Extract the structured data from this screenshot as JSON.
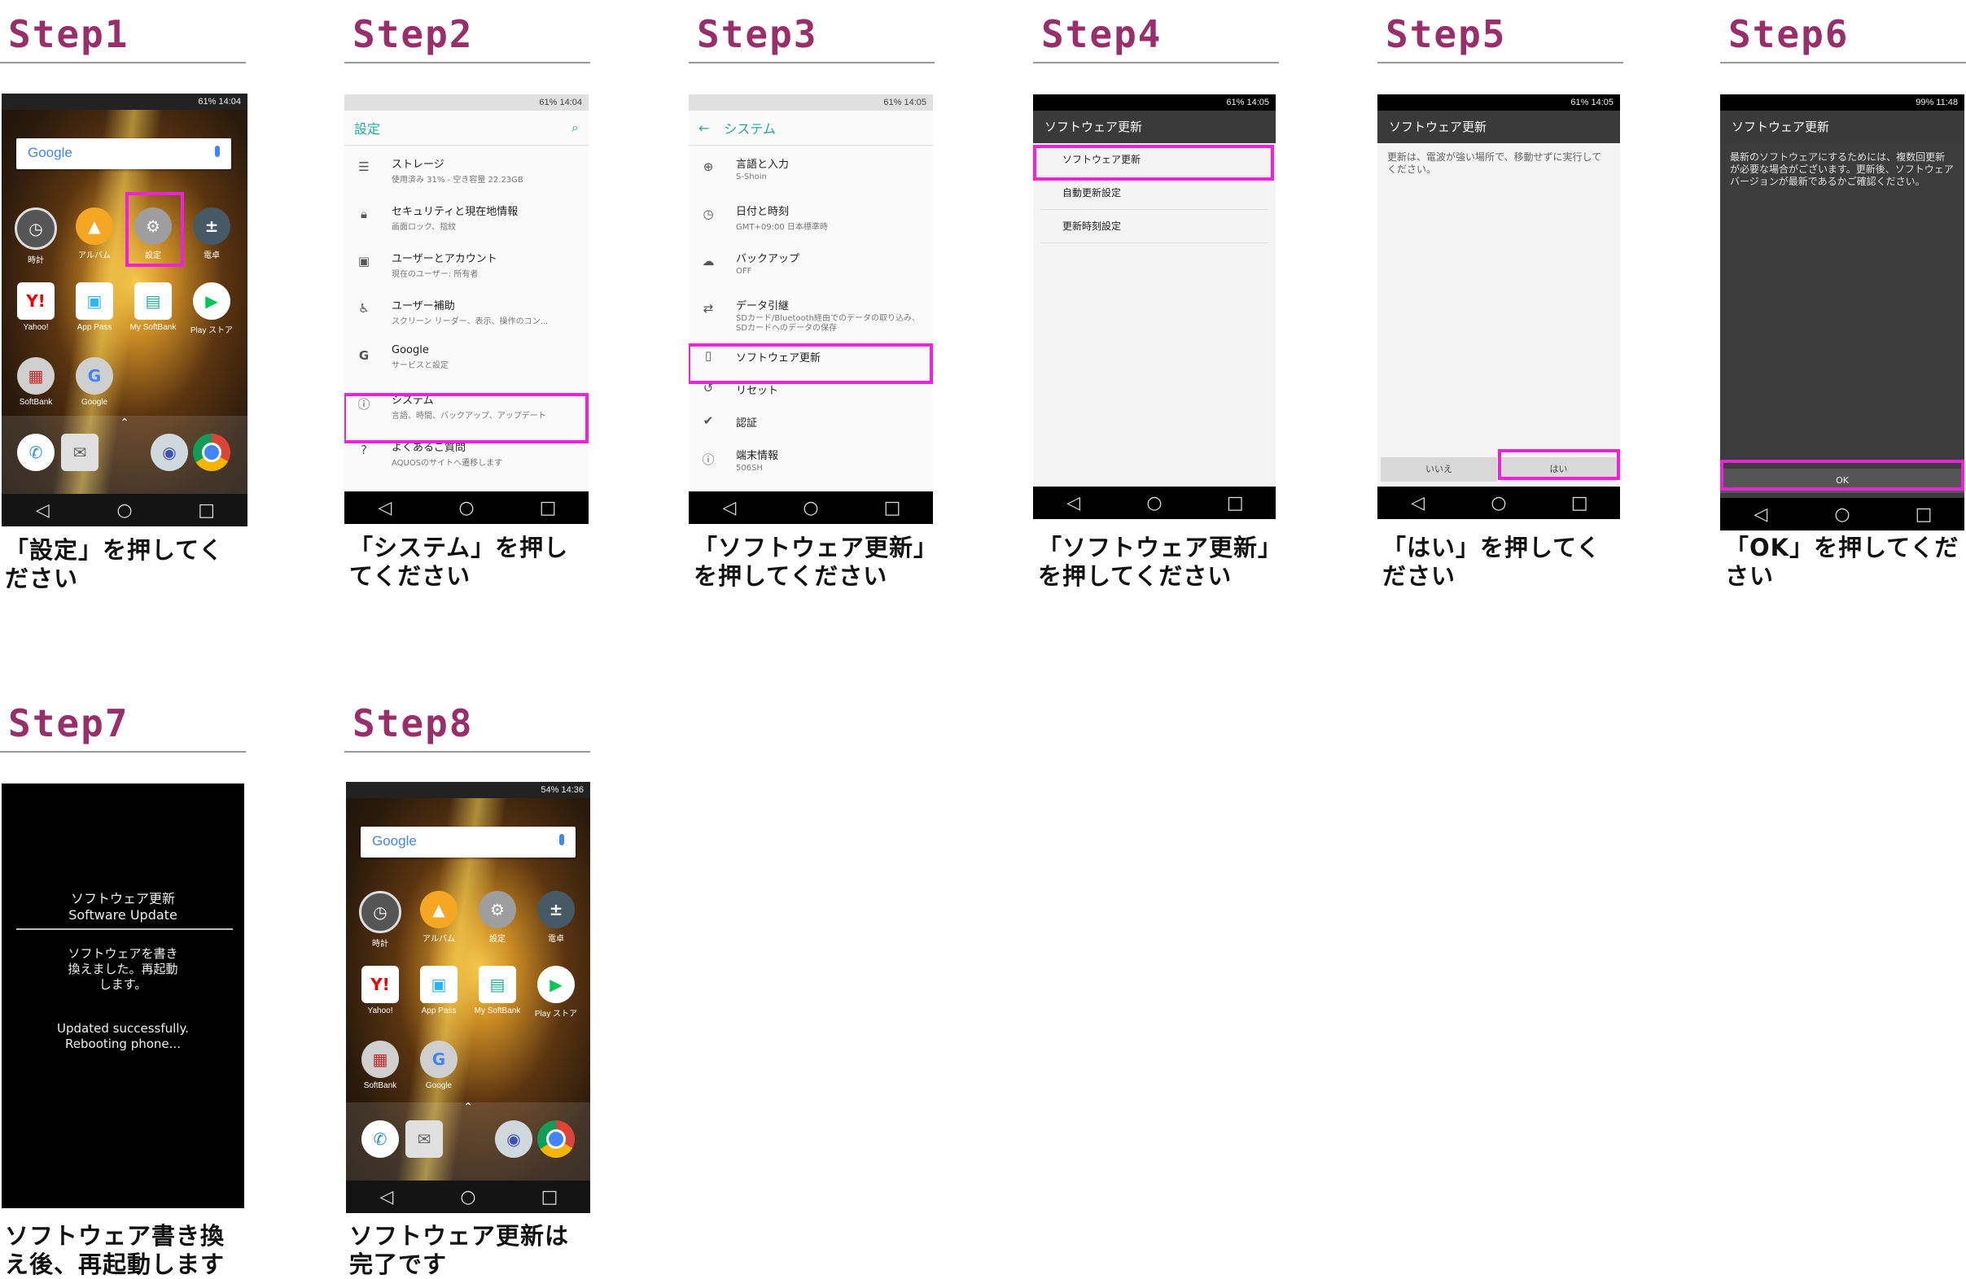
{
  "steps": [
    {
      "title": "Step1",
      "caption": "「設定」を押してください"
    },
    {
      "title": "Step2",
      "caption": "「システム」を押してください"
    },
    {
      "title": "Step3",
      "caption": "「ソフトウェア更新」を押してください"
    },
    {
      "title": "Step4",
      "caption": "「ソフトウェア更新」を押してください"
    },
    {
      "title": "Step5",
      "caption": "「はい」を押してください"
    },
    {
      "title": "Step6",
      "caption": "「OK」を押してください"
    },
    {
      "title": "Step7",
      "caption": "ソフトウェア書き換え後、再起動します"
    },
    {
      "title": "Step8",
      "caption": "ソフトウェア更新は完了です"
    }
  ],
  "home": {
    "google": "Google",
    "apps": [
      "時計",
      "アルバム",
      "設定",
      "電卓",
      "Yahoo!",
      "App Pass",
      "My SoftBank",
      "Play ストア",
      "SoftBank",
      "Google"
    ],
    "status1": "61% 14:04",
    "status8": "54% 14:36"
  },
  "settings": {
    "status": "61% 14:04",
    "title": "設定",
    "items": [
      {
        "title": "ストレージ",
        "sub": "使用済み 31% - 空き容量 22.23GB"
      },
      {
        "title": "セキュリティと現在地情報",
        "sub": "画面ロック、指紋"
      },
      {
        "title": "ユーザーとアカウント",
        "sub": "現在のユーザー: 所有者"
      },
      {
        "title": "ユーザー補助",
        "sub": "スクリーン リーダー、表示、操作のコン..."
      },
      {
        "title": "Google",
        "sub": "サービスと設定"
      },
      {
        "title": "システム",
        "sub": "言語、時間、バックアップ、アップデート"
      },
      {
        "title": "よくあるご質問",
        "sub": "AQUOSのサイトへ遷移します"
      }
    ]
  },
  "system": {
    "status": "61% 14:05",
    "title": "システム",
    "items": [
      {
        "title": "言語と入力",
        "sub": "S-Shoin"
      },
      {
        "title": "日付と時刻",
        "sub": "GMT+09:00 日本標準時"
      },
      {
        "title": "バックアップ",
        "sub": "OFF"
      },
      {
        "title": "データ引継",
        "sub": "SDカード/Bluetooth経由でのデータの取り込み、SDカードへのデータの保存"
      },
      {
        "title": "ソフトウェア更新",
        "sub": ""
      },
      {
        "title": "リセット",
        "sub": ""
      },
      {
        "title": "認証",
        "sub": ""
      },
      {
        "title": "端末情報",
        "sub": "506SH"
      }
    ]
  },
  "swupdate": {
    "status": "61% 14:05",
    "title": "ソフトウェア更新",
    "items": [
      "ソフトウェア更新",
      "自動更新設定",
      "更新時刻設定"
    ]
  },
  "confirm": {
    "status": "61% 14:05",
    "title": "ソフトウェア更新",
    "text": "更新は、電波が強い場所で、移動せずに実行してください。",
    "no": "いいえ",
    "yes": "はい"
  },
  "ok_dialog": {
    "status": "99% 11:48",
    "title": "ソフトウェア更新",
    "text": "最新のソフトウェアにするためには、複数回更新が必要な場合がございます。更新後、ソフトウェアバージョンが最新であるかご確認ください。",
    "ok": "OK"
  },
  "reboot": {
    "line1": "ソフトウェア更新",
    "line2": "Software Update",
    "jp": "ソフトウェアを書き換えました。再起動します。",
    "en1": "Updated successfully.",
    "en2": "Rebooting phone..."
  }
}
